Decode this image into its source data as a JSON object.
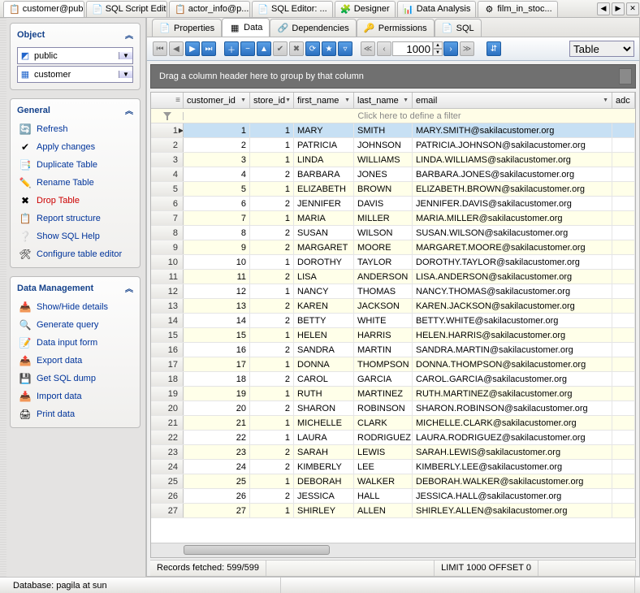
{
  "topTabs": [
    {
      "label": "customer@pub...",
      "icon": "📋",
      "active": true
    },
    {
      "label": "SQL Script Editor",
      "icon": "📄"
    },
    {
      "label": "actor_info@p...",
      "icon": "📋"
    },
    {
      "label": "SQL Editor: ...",
      "icon": "📄"
    },
    {
      "label": "Designer",
      "icon": "🧩"
    },
    {
      "label": "Data Analysis",
      "icon": "📊"
    },
    {
      "label": "film_in_stoc...",
      "icon": "⚙"
    }
  ],
  "sidebar": {
    "object": {
      "title": "Object",
      "schema": {
        "icon": "◩",
        "value": "public"
      },
      "table": {
        "icon": "▦",
        "value": "customer"
      }
    },
    "general": {
      "title": "General",
      "items": [
        {
          "icon": "🔄",
          "label": "Refresh",
          "name": "refresh"
        },
        {
          "icon": "✔",
          "label": "Apply changes",
          "name": "apply-changes"
        },
        {
          "icon": "📑",
          "label": "Duplicate Table",
          "name": "duplicate-table"
        },
        {
          "icon": "✏️",
          "label": "Rename Table",
          "name": "rename-table"
        },
        {
          "icon": "✖",
          "label": "Drop Table",
          "name": "drop-table",
          "danger": true
        },
        {
          "icon": "📋",
          "label": "Report structure",
          "name": "report-structure"
        },
        {
          "icon": "❔",
          "label": "Show SQL Help",
          "name": "show-sql-help"
        },
        {
          "icon": "🛠",
          "label": "Configure table editor",
          "name": "configure-table-editor"
        }
      ]
    },
    "dataMgmt": {
      "title": "Data Management",
      "items": [
        {
          "icon": "📥",
          "label": "Show/Hide details",
          "name": "show-hide-details"
        },
        {
          "icon": "🔍",
          "label": "Generate query",
          "name": "generate-query"
        },
        {
          "icon": "📝",
          "label": "Data input form",
          "name": "data-input-form"
        },
        {
          "icon": "📤",
          "label": "Export data",
          "name": "export-data"
        },
        {
          "icon": "💾",
          "label": "Get SQL dump",
          "name": "get-sql-dump"
        },
        {
          "icon": "📥",
          "label": "Import data",
          "name": "import-data"
        },
        {
          "icon": "🖨",
          "label": "Print data",
          "name": "print-data"
        }
      ]
    }
  },
  "subTabs": [
    {
      "label": "Properties",
      "icon": "📄"
    },
    {
      "label": "Data",
      "icon": "▦",
      "active": true
    },
    {
      "label": "Dependencies",
      "icon": "🔗"
    },
    {
      "label": "Permissions",
      "icon": "🔑"
    },
    {
      "label": "SQL",
      "icon": "📄"
    }
  ],
  "toolbar": {
    "recordCount": "1000",
    "viewMode": "Table"
  },
  "groupBar": "Drag a column header here to group by that column",
  "columns": [
    "customer_id",
    "store_id",
    "first_name",
    "last_name",
    "email",
    "adc"
  ],
  "filterHint": "Click here to define a filter",
  "rows": [
    {
      "n": 1,
      "cid": 1,
      "sid": 1,
      "fn": "MARY",
      "ln": "SMITH",
      "em": "MARY.SMITH@sakilacustomer.org"
    },
    {
      "n": 2,
      "cid": 2,
      "sid": 1,
      "fn": "PATRICIA",
      "ln": "JOHNSON",
      "em": "PATRICIA.JOHNSON@sakilacustomer.org"
    },
    {
      "n": 3,
      "cid": 3,
      "sid": 1,
      "fn": "LINDA",
      "ln": "WILLIAMS",
      "em": "LINDA.WILLIAMS@sakilacustomer.org"
    },
    {
      "n": 4,
      "cid": 4,
      "sid": 2,
      "fn": "BARBARA",
      "ln": "JONES",
      "em": "BARBARA.JONES@sakilacustomer.org"
    },
    {
      "n": 5,
      "cid": 5,
      "sid": 1,
      "fn": "ELIZABETH",
      "ln": "BROWN",
      "em": "ELIZABETH.BROWN@sakilacustomer.org"
    },
    {
      "n": 6,
      "cid": 6,
      "sid": 2,
      "fn": "JENNIFER",
      "ln": "DAVIS",
      "em": "JENNIFER.DAVIS@sakilacustomer.org"
    },
    {
      "n": 7,
      "cid": 7,
      "sid": 1,
      "fn": "MARIA",
      "ln": "MILLER",
      "em": "MARIA.MILLER@sakilacustomer.org"
    },
    {
      "n": 8,
      "cid": 8,
      "sid": 2,
      "fn": "SUSAN",
      "ln": "WILSON",
      "em": "SUSAN.WILSON@sakilacustomer.org"
    },
    {
      "n": 9,
      "cid": 9,
      "sid": 2,
      "fn": "MARGARET",
      "ln": "MOORE",
      "em": "MARGARET.MOORE@sakilacustomer.org"
    },
    {
      "n": 10,
      "cid": 10,
      "sid": 1,
      "fn": "DOROTHY",
      "ln": "TAYLOR",
      "em": "DOROTHY.TAYLOR@sakilacustomer.org"
    },
    {
      "n": 11,
      "cid": 11,
      "sid": 2,
      "fn": "LISA",
      "ln": "ANDERSON",
      "em": "LISA.ANDERSON@sakilacustomer.org"
    },
    {
      "n": 12,
      "cid": 12,
      "sid": 1,
      "fn": "NANCY",
      "ln": "THOMAS",
      "em": "NANCY.THOMAS@sakilacustomer.org"
    },
    {
      "n": 13,
      "cid": 13,
      "sid": 2,
      "fn": "KAREN",
      "ln": "JACKSON",
      "em": "KAREN.JACKSON@sakilacustomer.org"
    },
    {
      "n": 14,
      "cid": 14,
      "sid": 2,
      "fn": "BETTY",
      "ln": "WHITE",
      "em": "BETTY.WHITE@sakilacustomer.org"
    },
    {
      "n": 15,
      "cid": 15,
      "sid": 1,
      "fn": "HELEN",
      "ln": "HARRIS",
      "em": "HELEN.HARRIS@sakilacustomer.org"
    },
    {
      "n": 16,
      "cid": 16,
      "sid": 2,
      "fn": "SANDRA",
      "ln": "MARTIN",
      "em": "SANDRA.MARTIN@sakilacustomer.org"
    },
    {
      "n": 17,
      "cid": 17,
      "sid": 1,
      "fn": "DONNA",
      "ln": "THOMPSON",
      "em": "DONNA.THOMPSON@sakilacustomer.org"
    },
    {
      "n": 18,
      "cid": 18,
      "sid": 2,
      "fn": "CAROL",
      "ln": "GARCIA",
      "em": "CAROL.GARCIA@sakilacustomer.org"
    },
    {
      "n": 19,
      "cid": 19,
      "sid": 1,
      "fn": "RUTH",
      "ln": "MARTINEZ",
      "em": "RUTH.MARTINEZ@sakilacustomer.org"
    },
    {
      "n": 20,
      "cid": 20,
      "sid": 2,
      "fn": "SHARON",
      "ln": "ROBINSON",
      "em": "SHARON.ROBINSON@sakilacustomer.org"
    },
    {
      "n": 21,
      "cid": 21,
      "sid": 1,
      "fn": "MICHELLE",
      "ln": "CLARK",
      "em": "MICHELLE.CLARK@sakilacustomer.org"
    },
    {
      "n": 22,
      "cid": 22,
      "sid": 1,
      "fn": "LAURA",
      "ln": "RODRIGUEZ",
      "em": "LAURA.RODRIGUEZ@sakilacustomer.org"
    },
    {
      "n": 23,
      "cid": 23,
      "sid": 2,
      "fn": "SARAH",
      "ln": "LEWIS",
      "em": "SARAH.LEWIS@sakilacustomer.org"
    },
    {
      "n": 24,
      "cid": 24,
      "sid": 2,
      "fn": "KIMBERLY",
      "ln": "LEE",
      "em": "KIMBERLY.LEE@sakilacustomer.org"
    },
    {
      "n": 25,
      "cid": 25,
      "sid": 1,
      "fn": "DEBORAH",
      "ln": "WALKER",
      "em": "DEBORAH.WALKER@sakilacustomer.org"
    },
    {
      "n": 26,
      "cid": 26,
      "sid": 2,
      "fn": "JESSICA",
      "ln": "HALL",
      "em": "JESSICA.HALL@sakilacustomer.org"
    },
    {
      "n": 27,
      "cid": 27,
      "sid": 1,
      "fn": "SHIRLEY",
      "ln": "ALLEN",
      "em": "SHIRLEY.ALLEN@sakilacustomer.org"
    }
  ],
  "status1": {
    "records": "Records fetched: 599/599",
    "limit": "LIMIT 1000 OFFSET 0"
  },
  "status2": {
    "db": "Database: pagila at sun"
  }
}
